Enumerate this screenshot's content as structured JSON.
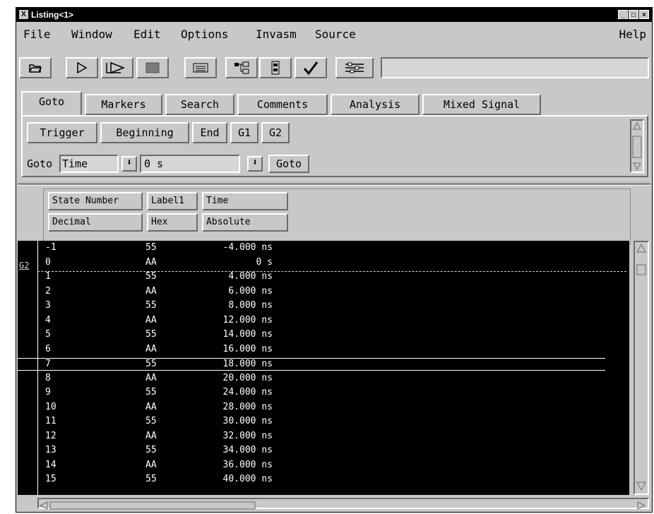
{
  "window": {
    "title": "Listing<1>",
    "controls": [
      "_",
      "□",
      "×"
    ]
  },
  "menubar": {
    "items": [
      "File",
      "Window",
      "Edit",
      "Options",
      "Invasm",
      "Source"
    ],
    "help": "Help"
  },
  "toolbar": {
    "buttons": [
      "open-icon",
      "run-icon",
      "run-repetitive-icon",
      "stop-icon",
      "listing-icon",
      "hierarchy-icon",
      "module-icon",
      "check-icon",
      "settings-icon"
    ],
    "field_value": ""
  },
  "tabs": {
    "items": [
      "Goto",
      "Markers",
      "Search",
      "Comments",
      "Analysis",
      "Mixed Signal"
    ],
    "active": "Goto"
  },
  "goto_panel": {
    "buttons": [
      "Trigger",
      "Beginning",
      "End",
      "G1",
      "G2"
    ],
    "goto_label": "Goto",
    "mode_value": "Time",
    "time_value": "0 s",
    "goto_button": "Goto"
  },
  "columns": {
    "headers": [
      "State Number",
      "Label1",
      "Time"
    ],
    "formats": [
      "Decimal",
      "Hex",
      "Absolute"
    ]
  },
  "listing": {
    "marker_label": "G2",
    "highlighted_state": "7",
    "rows": [
      {
        "state": "-1",
        "label1": "55",
        "time": "-4.000 ns"
      },
      {
        "state": "0",
        "label1": "AA",
        "time": "0 s"
      },
      {
        "state": "1",
        "label1": "55",
        "time": "4.000 ns"
      },
      {
        "state": "2",
        "label1": "AA",
        "time": "6.000 ns"
      },
      {
        "state": "3",
        "label1": "55",
        "time": "8.000 ns"
      },
      {
        "state": "4",
        "label1": "AA",
        "time": "12.000 ns"
      },
      {
        "state": "5",
        "label1": "55",
        "time": "14.000 ns"
      },
      {
        "state": "6",
        "label1": "AA",
        "time": "16.000 ns"
      },
      {
        "state": "7",
        "label1": "55",
        "time": "18.000 ns"
      },
      {
        "state": "8",
        "label1": "AA",
        "time": "20.000 ns"
      },
      {
        "state": "9",
        "label1": "55",
        "time": "24.000 ns"
      },
      {
        "state": "10",
        "label1": "AA",
        "time": "28.000 ns"
      },
      {
        "state": "11",
        "label1": "55",
        "time": "30.000 ns"
      },
      {
        "state": "12",
        "label1": "AA",
        "time": "32.000 ns"
      },
      {
        "state": "13",
        "label1": "55",
        "time": "34.000 ns"
      },
      {
        "state": "14",
        "label1": "AA",
        "time": "36.000 ns"
      },
      {
        "state": "15",
        "label1": "55",
        "time": "40.000 ns"
      }
    ]
  }
}
